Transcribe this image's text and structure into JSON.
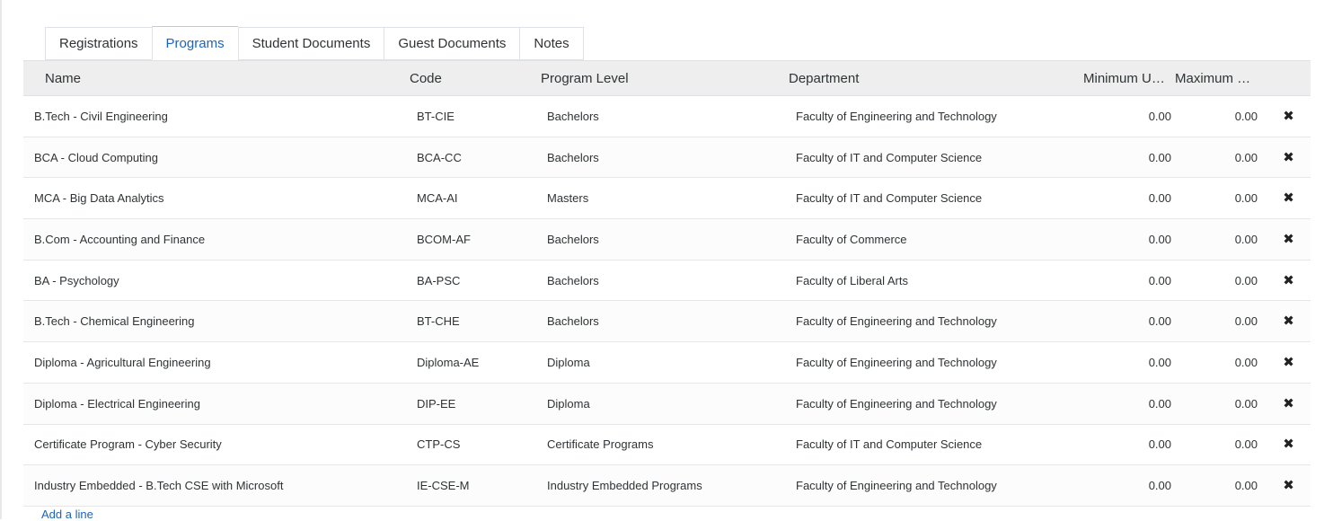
{
  "tabs": [
    {
      "label": "Registrations",
      "active": false
    },
    {
      "label": "Programs",
      "active": true
    },
    {
      "label": "Student Documents",
      "active": false
    },
    {
      "label": "Guest Documents",
      "active": false
    },
    {
      "label": "Notes",
      "active": false
    }
  ],
  "table": {
    "headers": {
      "name": "Name",
      "code": "Code",
      "level": "Program Level",
      "department": "Department",
      "min": "Minimum Units",
      "max": "Maximum Units"
    },
    "rows": [
      {
        "name": "B.Tech - Civil Engineering",
        "code": "BT-CIE",
        "level": "Bachelors",
        "department": "Faculty of Engineering and Technology",
        "min": "0.00",
        "max": "0.00"
      },
      {
        "name": "BCA - Cloud Computing",
        "code": "BCA-CC",
        "level": "Bachelors",
        "department": "Faculty of IT and Computer Science",
        "min": "0.00",
        "max": "0.00"
      },
      {
        "name": "MCA - Big Data Analytics",
        "code": "MCA-AI",
        "level": "Masters",
        "department": "Faculty of IT and Computer Science",
        "min": "0.00",
        "max": "0.00"
      },
      {
        "name": "B.Com - Accounting and Finance",
        "code": "BCOM-AF",
        "level": "Bachelors",
        "department": "Faculty of Commerce",
        "min": "0.00",
        "max": "0.00"
      },
      {
        "name": "BA - Psychology",
        "code": "BA-PSC",
        "level": "Bachelors",
        "department": "Faculty of Liberal Arts",
        "min": "0.00",
        "max": "0.00"
      },
      {
        "name": "B.Tech - Chemical Engineering",
        "code": "BT-CHE",
        "level": "Bachelors",
        "department": "Faculty of Engineering and Technology",
        "min": "0.00",
        "max": "0.00"
      },
      {
        "name": "Diploma - Agricultural Engineering",
        "code": "Diploma-AE",
        "level": "Diploma",
        "department": "Faculty of Engineering and Technology",
        "min": "0.00",
        "max": "0.00"
      },
      {
        "name": "Diploma - Electrical Engineering",
        "code": "DIP-EE",
        "level": "Diploma",
        "department": "Faculty of Engineering and Technology",
        "min": "0.00",
        "max": "0.00"
      },
      {
        "name": "Certificate Program - Cyber Security",
        "code": "CTP-CS",
        "level": "Certificate Programs",
        "department": "Faculty of IT and Computer Science",
        "min": "0.00",
        "max": "0.00"
      },
      {
        "name": "Industry Embedded - B.Tech CSE with Microsoft",
        "code": "IE-CSE-M",
        "level": "Industry Embedded Programs",
        "department": "Faculty of Engineering and Technology",
        "min": "0.00",
        "max": "0.00"
      }
    ],
    "delete_icon": "close-icon",
    "delete_glyph": "✖"
  },
  "actions": {
    "add_line_label": "Add a line"
  },
  "colors": {
    "accent": "#1f63b8",
    "header_bg": "#eeeeee",
    "text": "#2f3335",
    "border": "#dee2e6"
  }
}
